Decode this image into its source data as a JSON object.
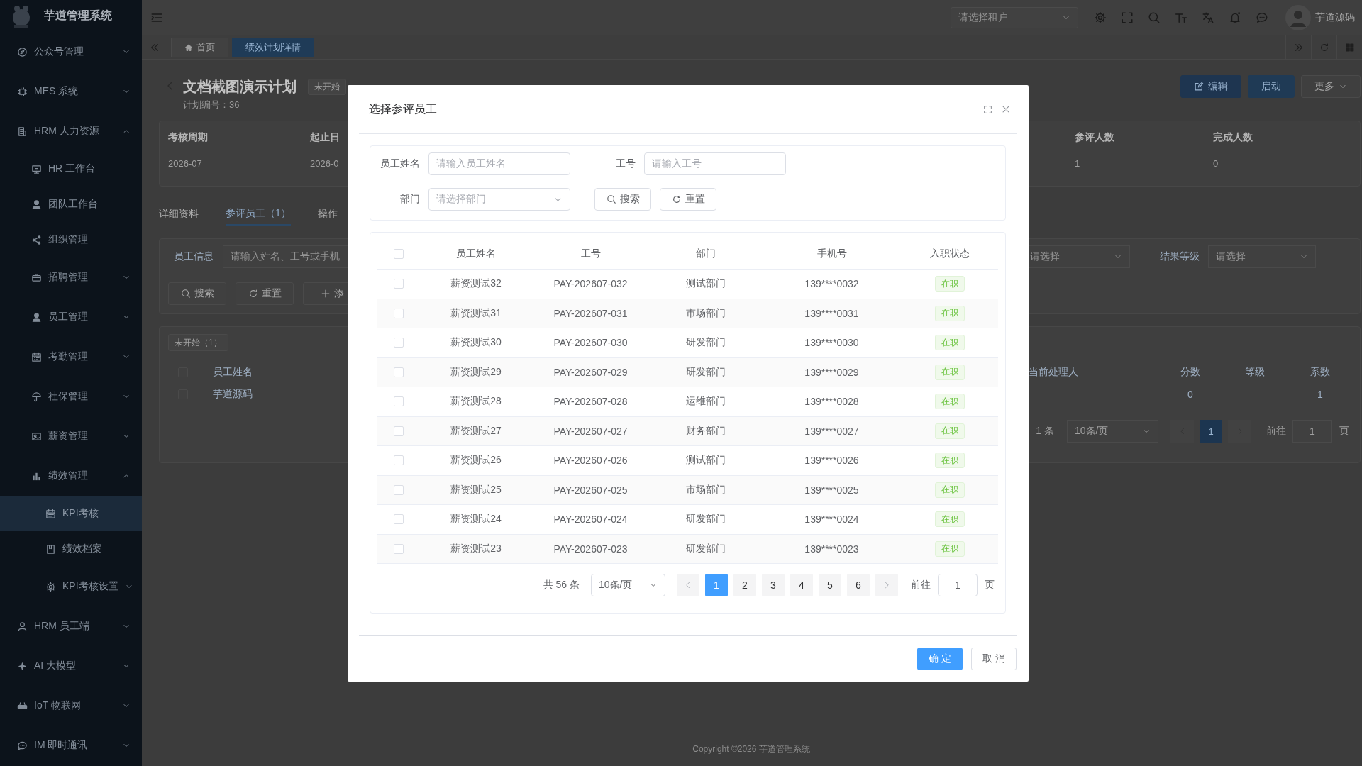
{
  "sidebar": {
    "logo_text": "芋道管理系统",
    "items": [
      {
        "label": "公众号管理",
        "expanded": false,
        "selected": false
      },
      {
        "label": "MES 系统",
        "expanded": false,
        "selected": false
      },
      {
        "label": "HRM 人力资源",
        "expanded": true,
        "selected": false,
        "children": [
          {
            "label": "HR 工作台",
            "selected": false
          },
          {
            "label": "团队工作台",
            "selected": false
          },
          {
            "label": "组织管理",
            "selected": false
          },
          {
            "label": "招聘管理",
            "expanded": false,
            "selected": false
          },
          {
            "label": "员工管理",
            "expanded": false,
            "selected": false
          },
          {
            "label": "考勤管理",
            "expanded": false,
            "selected": false
          },
          {
            "label": "社保管理",
            "expanded": false,
            "selected": false
          },
          {
            "label": "薪资管理",
            "expanded": false,
            "selected": false
          },
          {
            "label": "绩效管理",
            "expanded": true,
            "selected": false,
            "children": [
              {
                "label": "KPI考核",
                "selected": true
              },
              {
                "label": "绩效档案",
                "selected": false
              },
              {
                "label": "KPI考核设置",
                "expanded": false,
                "selected": false
              }
            ]
          }
        ]
      },
      {
        "label": "HRM 员工端",
        "expanded": false,
        "selected": false
      },
      {
        "label": "AI 大模型",
        "expanded": false,
        "selected": false
      },
      {
        "label": "IoT 物联网",
        "expanded": false,
        "selected": false
      },
      {
        "label": "IM 即时通讯",
        "expanded": false,
        "selected": false
      }
    ]
  },
  "header": {
    "tenant_select": {
      "placeholder": "请选择租户"
    },
    "user_name": "芋道源码"
  },
  "tabs": [
    {
      "label": "首页",
      "selected": false
    },
    {
      "label": "绩效计划详情",
      "selected": true
    }
  ],
  "page": {
    "title": "文档截图演示计划",
    "status_tag": "未开始",
    "plan_no": "计划编号：36",
    "actions": [
      {
        "label": "编辑",
        "kind": "edit"
      },
      {
        "label": "启动",
        "kind": "primary"
      },
      {
        "label": "更多",
        "kind": "more"
      }
    ],
    "summary_left": [
      {
        "label": "考核周期",
        "value": "2026-07"
      },
      {
        "label": "起止日",
        "value": "2026-0"
      }
    ],
    "summary_right": [
      {
        "label": "参评人数",
        "value": "1"
      },
      {
        "label": "完成人数",
        "value": "0"
      }
    ],
    "detail_tabs": [
      {
        "label": "详细资料",
        "selected": false
      },
      {
        "label": "参评员工（1）",
        "selected": true
      },
      {
        "label": "操作",
        "selected": false
      }
    ],
    "filter": {
      "field_label": "员工信息",
      "field_placeholder": "请输入姓名、工号或手机",
      "select_placeholder": "请选择",
      "grade_label": "结果等级",
      "grade_placeholder": "请选择",
      "buttons": [
        {
          "label": "搜索",
          "kind": "search"
        },
        {
          "label": "重置",
          "kind": "reset"
        },
        {
          "label": "添",
          "kind": "add"
        }
      ]
    },
    "status_filter_tag": "未开始（1）",
    "table": {
      "all_checked": false,
      "columns_left": [
        "员工姓名"
      ],
      "columns_right": [
        "当前处理人",
        "分数",
        "等级",
        "系数"
      ],
      "rows": [
        {
          "name": "芋道源码",
          "score": "0",
          "coefficient": "1",
          "checked": false
        }
      ]
    },
    "pagination": {
      "total": "1 条",
      "page_size": "10条/页",
      "pages": [
        {
          "label": "1",
          "selected": true
        }
      ],
      "goto_label": "前往",
      "goto_value": "1",
      "page_unit": "页"
    },
    "footer": "Copyright ©2026 芋道管理系统"
  },
  "dialog": {
    "title": "选择参评员工",
    "search": {
      "fields": [
        {
          "label": "员工姓名",
          "placeholder": "请输入员工姓名",
          "kind": "input"
        },
        {
          "label": "工号",
          "placeholder": "请输入工号",
          "kind": "input"
        },
        {
          "label": "部门",
          "placeholder": "请选择部门",
          "kind": "select"
        }
      ],
      "buttons": [
        {
          "label": "搜索",
          "kind": "search"
        },
        {
          "label": "重置",
          "kind": "reset"
        }
      ]
    },
    "table": {
      "all_checked": false,
      "columns": [
        "员工姓名",
        "工号",
        "部门",
        "手机号",
        "入职状态"
      ],
      "rows": [
        {
          "name": "薪资测试32",
          "employee_no": "PAY-202607-032",
          "department": "测试部门",
          "phone": "139****0032",
          "status": "在职",
          "checked": false
        },
        {
          "name": "薪资测试31",
          "employee_no": "PAY-202607-031",
          "department": "市场部门",
          "phone": "139****0031",
          "status": "在职",
          "checked": false
        },
        {
          "name": "薪资测试30",
          "employee_no": "PAY-202607-030",
          "department": "研发部门",
          "phone": "139****0030",
          "status": "在职",
          "checked": false
        },
        {
          "name": "薪资测试29",
          "employee_no": "PAY-202607-029",
          "department": "研发部门",
          "phone": "139****0029",
          "status": "在职",
          "checked": false
        },
        {
          "name": "薪资测试28",
          "employee_no": "PAY-202607-028",
          "department": "运维部门",
          "phone": "139****0028",
          "status": "在职",
          "checked": false
        },
        {
          "name": "薪资测试27",
          "employee_no": "PAY-202607-027",
          "department": "财务部门",
          "phone": "139****0027",
          "status": "在职",
          "checked": false
        },
        {
          "name": "薪资测试26",
          "employee_no": "PAY-202607-026",
          "department": "测试部门",
          "phone": "139****0026",
          "status": "在职",
          "checked": false
        },
        {
          "name": "薪资测试25",
          "employee_no": "PAY-202607-025",
          "department": "市场部门",
          "phone": "139****0025",
          "status": "在职",
          "checked": false
        },
        {
          "name": "薪资测试24",
          "employee_no": "PAY-202607-024",
          "department": "研发部门",
          "phone": "139****0024",
          "status": "在职",
          "checked": false
        },
        {
          "name": "薪资测试23",
          "employee_no": "PAY-202607-023",
          "department": "研发部门",
          "phone": "139****0023",
          "status": "在职",
          "checked": false
        }
      ]
    },
    "pagination": {
      "total": "共 56 条",
      "page_size": "10条/页",
      "pages": [
        {
          "label": "1",
          "selected": true
        },
        {
          "label": "2",
          "selected": false
        },
        {
          "label": "3",
          "selected": false
        },
        {
          "label": "4",
          "selected": false
        },
        {
          "label": "5",
          "selected": false
        },
        {
          "label": "6",
          "selected": false
        }
      ],
      "goto_label": "前往",
      "goto_value": "1",
      "page_unit": "页"
    },
    "buttons": [
      {
        "label": "确 定",
        "kind": "primary"
      },
      {
        "label": "取 消",
        "kind": "default"
      }
    ]
  }
}
